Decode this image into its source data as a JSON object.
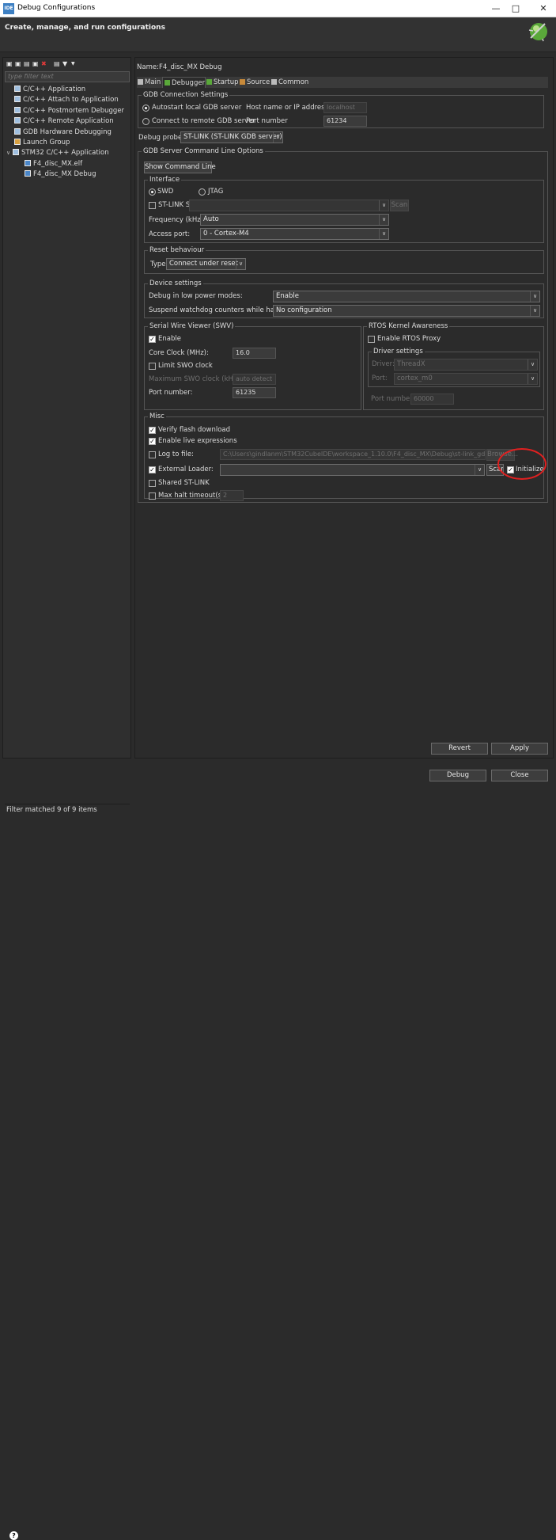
{
  "window": {
    "title": "Debug Configurations",
    "app_badge": "IDE"
  },
  "header": {
    "title": "Create, manage, and run configurations"
  },
  "left": {
    "filter_placeholder": "type filter text",
    "tree": [
      {
        "label": "C/C++ Application"
      },
      {
        "label": "C/C++ Attach to Application"
      },
      {
        "label": "C/C++ Postmortem Debugger"
      },
      {
        "label": "C/C++ Remote Application"
      },
      {
        "label": "GDB Hardware Debugging"
      },
      {
        "label": "Launch Group"
      },
      {
        "label": "STM32 C/C++ Application"
      },
      {
        "label": "F4_disc_MX.elf"
      },
      {
        "label": "F4_disc_MX Debug"
      }
    ],
    "status": "Filter matched 9 of 9 items"
  },
  "config": {
    "name_label": "Name:",
    "name_value": "F4_disc_MX Debug",
    "tabs": [
      "Main",
      "Debugger",
      "Startup",
      "Source",
      "Common"
    ],
    "gdb": {
      "title": "GDB Connection Settings",
      "autostart": "Autostart local GDB server",
      "connect_remote": "Connect to remote GDB server",
      "host_label": "Host name or IP address",
      "host_value": "localhost",
      "port_label": "Port number",
      "port_value": "61234"
    },
    "probe_label": "Debug probe",
    "probe_value": "ST-LINK (ST-LINK GDB server)",
    "server": {
      "title": "GDB Server Command Line Options",
      "show_cmd": "Show Command Line"
    },
    "interface": {
      "title": "Interface",
      "swd": "SWD",
      "jtag": "JTAG",
      "stlink_sn": "ST-LINK S/N",
      "scan": "Scan",
      "freq_label": "Frequency (kHz):",
      "freq_value": "Auto",
      "access_label": "Access port:",
      "access_value": "0 - Cortex-M4"
    },
    "reset": {
      "title": "Reset behaviour",
      "type_label": "Type:",
      "type_value": "Connect under reset"
    },
    "device": {
      "title": "Device settings",
      "low_power_label": "Debug in low power modes:",
      "low_power_value": "Enable",
      "watchdog_label": "Suspend watchdog counters while halted:",
      "watchdog_value": "No configuration"
    },
    "swv": {
      "title": "Serial Wire Viewer (SWV)",
      "enable": "Enable",
      "core_clock_label": "Core Clock (MHz):",
      "core_clock_value": "16.0",
      "limit_swo": "Limit SWO clock",
      "max_swo_label": "Maximum SWO clock (kHz):",
      "max_swo_value": "auto detect",
      "port_label": "Port number:",
      "port_value": "61235"
    },
    "rtos": {
      "title": "RTOS Kernel Awareness",
      "enable_proxy": "Enable RTOS Proxy",
      "driver_title": "Driver settings",
      "driver_label": "Driver:",
      "driver_value": "ThreadX",
      "port_label": "Port:",
      "port_value": "cortex_m0",
      "port_number_label": "Port number:",
      "port_number_value": "60000"
    },
    "misc": {
      "title": "Misc",
      "verify": "Verify flash download",
      "live_expr": "Enable live expressions",
      "log_label": "Log to file:",
      "log_value": "C:\\Users\\gindlanm\\STM32CubeIDE\\workspace_1.10.0\\F4_disc_MX\\Debug\\st-link_gdbserv",
      "browse": "Browse...",
      "ext_loader": "External Loader:",
      "scan": "Scan",
      "initialize": "Initialize",
      "shared": "Shared ST-LINK",
      "max_halt": "Max halt timeout(s):",
      "max_halt_value": "2"
    }
  },
  "buttons": {
    "revert": "Revert",
    "apply": "Apply",
    "debug": "Debug",
    "close": "Close"
  },
  "colors": {
    "highlight_circle": "#e02020"
  }
}
